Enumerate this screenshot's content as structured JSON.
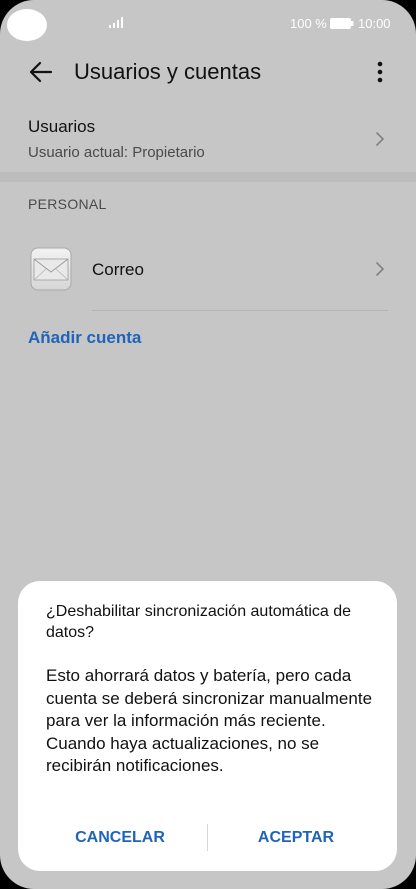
{
  "status_bar": {
    "battery_label": "100 %",
    "time": "10:00"
  },
  "header": {
    "title": "Usuarios y cuentas",
    "back_icon": "arrow-left-icon",
    "more_icon": "vertical-dots-icon"
  },
  "users": {
    "title": "Usuarios",
    "subtitle": "Usuario actual: Propietario"
  },
  "section": {
    "header": "PERSONAL"
  },
  "accounts": [
    {
      "label": "Correo",
      "icon": "envelope-icon"
    }
  ],
  "add_account": "Añadir cuenta",
  "dialog": {
    "title": "¿Deshabilitar sincronización automática de datos?",
    "message": "Esto ahorrará datos y batería, pero cada cuenta se deberá sincronizar manualmente para ver la información más reciente. Cuando haya actualizaciones, no se recibirán notificaciones.",
    "cancel_label": "CANCELAR",
    "accept_label": "ACEPTAR"
  },
  "colors": {
    "accent": "#1f64b8",
    "background_dimmed": "#c6c6c6",
    "dialog_bg": "#ffffff"
  }
}
